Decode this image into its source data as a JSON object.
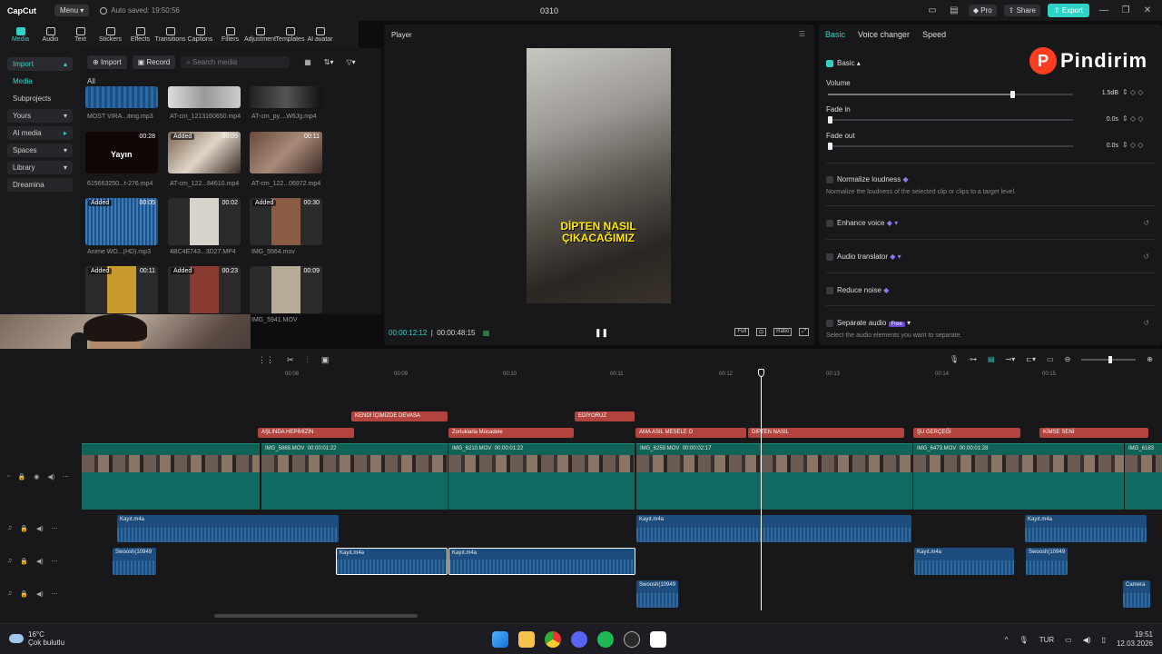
{
  "titlebar": {
    "app_name": "CapCut",
    "menu_label": "Menu",
    "autosave": "Auto saved: 19:50:56",
    "project_title": "0310",
    "pro_label": "Pro",
    "share_label": "Share",
    "export_label": "Export"
  },
  "toolbar": {
    "items": [
      "Media",
      "Audio",
      "Text",
      "Stickers",
      "Effects",
      "Transitions",
      "Captions",
      "Filters",
      "Adjustment",
      "Templates",
      "AI avatar"
    ]
  },
  "sidenav": {
    "import": "Import",
    "media": "Media",
    "subprojects": "Subprojects",
    "yours": "Yours",
    "ai_media": "AI media",
    "spaces": "Spaces",
    "library": "Library",
    "dreamina": "Dreamina"
  },
  "media": {
    "import_btn": "Import",
    "record_btn": "Record",
    "search_placeholder": "Search media",
    "all_label": "All",
    "items": [
      {
        "name": "MOST VIRA...iting.mp3",
        "tag": "",
        "dur": ""
      },
      {
        "name": "AT-cm_1213160650.mp4",
        "tag": "",
        "dur": ""
      },
      {
        "name": "AT-cm_py....W6Jg.mp4",
        "tag": "",
        "dur": ""
      },
      {
        "name": "615663250...t-276.mp4",
        "tag": "",
        "dur": "00:28"
      },
      {
        "name": "AT-cm_122...84610.mp4",
        "tag": "Added",
        "dur": "00:05"
      },
      {
        "name": "AT-cm_122...06972.mp4",
        "tag": "",
        "dur": "00:11"
      },
      {
        "name": "Anime WO...(HD).mp3",
        "tag": "Added",
        "dur": "00:05"
      },
      {
        "name": "4BC4E743...3D27.MP4",
        "tag": "",
        "dur": "00:02"
      },
      {
        "name": "IMG_5564.mov",
        "tag": "Added",
        "dur": "00:30"
      },
      {
        "name": "",
        "tag": "Added",
        "dur": "00:11"
      },
      {
        "name": "",
        "tag": "Added",
        "dur": "00:23"
      },
      {
        "name": "IMG_5941.MOV",
        "tag": "",
        "dur": "00:09"
      }
    ],
    "thumb_caption": "Yayın"
  },
  "player": {
    "title": "Player",
    "caption_line1": "DİPTEN NASIL",
    "caption_line2": "ÇIKACAĞIMIZ",
    "current_time": "00:00:12:12",
    "total_time": "00:00:48:15",
    "full_label": "Full",
    "ratio_label": "Ratio"
  },
  "inspector": {
    "tabs": [
      "Basic",
      "Voice changer",
      "Speed"
    ],
    "banner": "Pindirim",
    "section": "Basic",
    "volume_label": "Volume",
    "volume_value": "1.5dB",
    "volume_level": 0.75,
    "fade_in_label": "Fade in",
    "fade_in_value": "0.0s",
    "fade_out_label": "Fade out",
    "fade_out_value": "0.0s",
    "normalize_label": "Normalize loudness",
    "normalize_desc": "Normalize the loudness of the selected clip or clips to a target level.",
    "enhance_label": "Enhance voice",
    "translator_label": "Audio translator",
    "reduce_label": "Reduce noise",
    "separate_label": "Separate audio",
    "separate_badge": "Free",
    "separate_desc": "Select the audio elements you want to separate."
  },
  "timeline": {
    "ruler": [
      "00:08",
      "00:09",
      "00:10",
      "00:11",
      "00:12",
      "00:13",
      "00:14",
      "00:15"
    ],
    "text_top": [
      "KENDİ İÇİMİZDE DEVASA",
      "EDİYORUZ"
    ],
    "text_bottom": [
      "AŞLINDA HEPİMİZİN",
      "Zorluklarla Mücadele",
      "AMA ASIL MESELE O",
      "DİPTEN NASIL",
      "ŞU GERÇEĞİ",
      "KİMSE SENİ"
    ],
    "video_clips": [
      {
        "name": "IMG_5869.MOV",
        "dur": "00:00:01:22"
      },
      {
        "name": "IMG_6210.MOV",
        "dur": "00:00:01:22"
      },
      {
        "name": "IMG_6259.MOV",
        "dur": "00:00:02:17"
      },
      {
        "name": "IMG_6473.MOV",
        "dur": "00:00:01:28"
      },
      {
        "name": "IMG_6183",
        "dur": ""
      }
    ],
    "audio1": [
      "Kayıt.m4a",
      "Kayıt.m4a",
      "Kayıt.m4a"
    ],
    "audio2": [
      "Swoosh(10949",
      "Kayıt.m4a",
      "Kayıt.m4a",
      "Kayıt.m4a",
      "Swoosh(10949"
    ],
    "audio3": [
      "Swoosh(10949",
      "Camera"
    ]
  },
  "taskbar": {
    "temp": "16°C",
    "weather": "Çok bulutlu",
    "lang": "TUR",
    "time": "19:51",
    "date": "12.03.2026"
  }
}
